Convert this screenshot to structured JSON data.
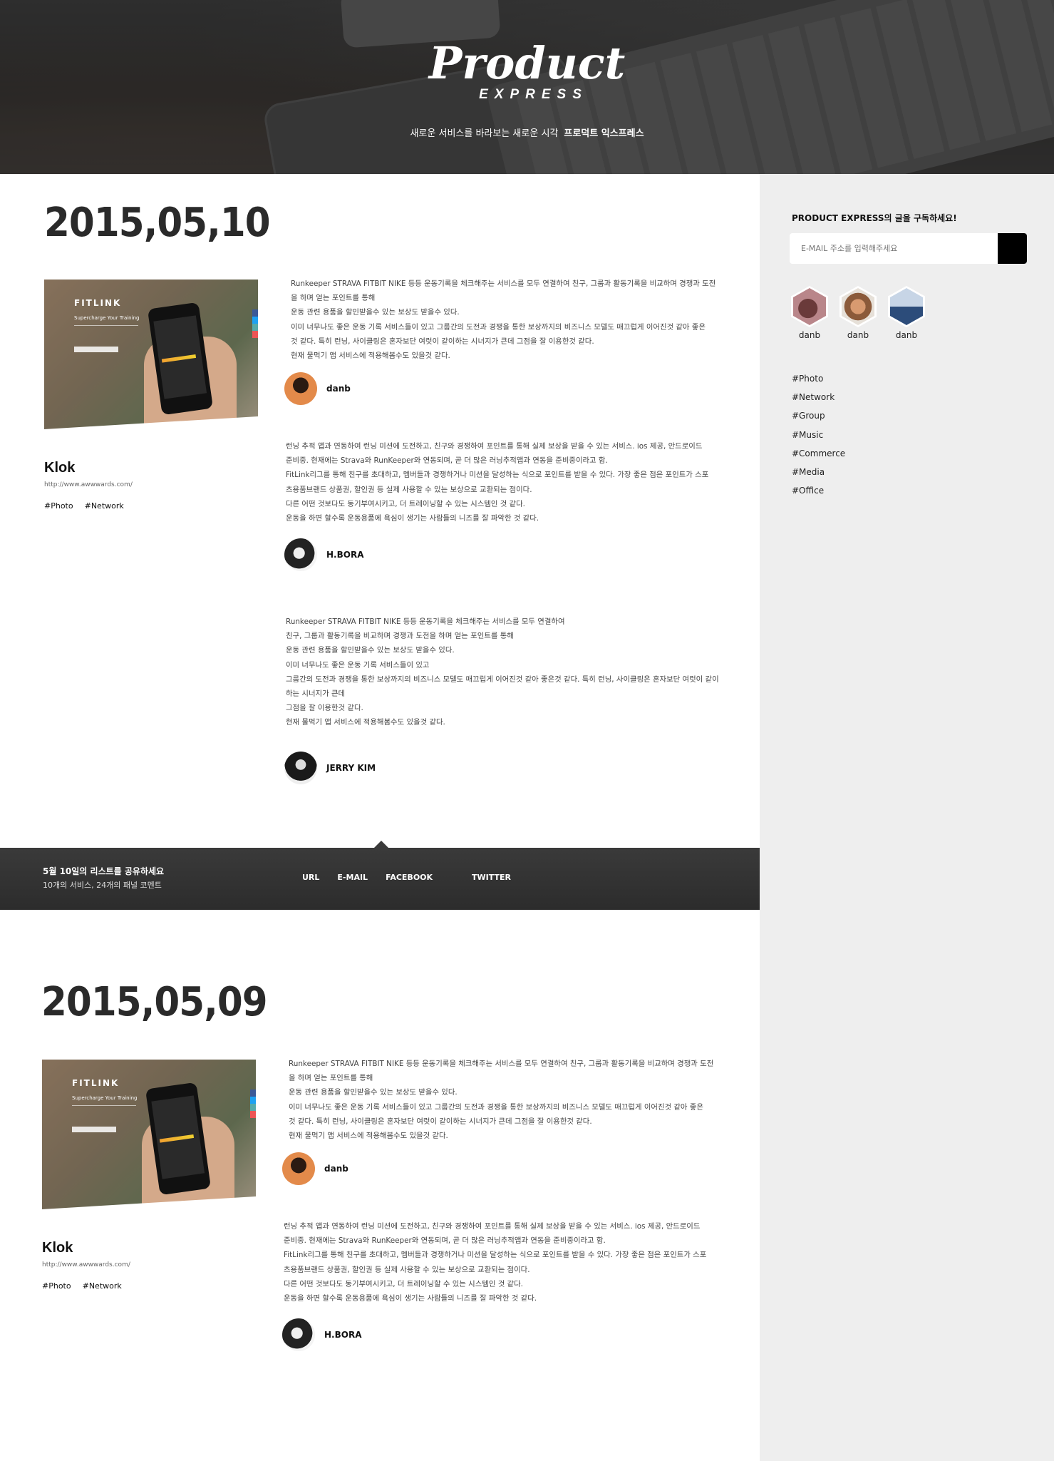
{
  "header": {
    "logo_main": "Product",
    "logo_sub": "EXPRESS",
    "tagline": "새로운 서비스를 바라보는 새로운 시각",
    "tagline_bold": "프로덕트 익스프레스"
  },
  "sidebar": {
    "subscribe_title": "PRODUCT EXPRESS의 글을 구독하세요!",
    "email_placeholder": "E-MAIL 주소를 입력해주세요",
    "users": [
      {
        "name": "danb"
      },
      {
        "name": "danb"
      },
      {
        "name": "danb"
      }
    ],
    "tags": [
      "#Photo",
      "#Network",
      "#Group",
      "#Music",
      "#Commerce",
      "#Media",
      "#Office"
    ]
  },
  "days": [
    {
      "date": "2015,05,10",
      "product": {
        "thumb_brand": "FITLINK",
        "thumb_tagline": "Supercharge Your Training",
        "name": "Klok",
        "url": "http://www.awwwards.com/",
        "tags": [
          "#Photo",
          "#Network"
        ]
      },
      "comments": [
        {
          "lines": [
            "Runkeeper STRAVA FITBIT NIKE 등등 운동기록을 체크해주는 서비스를 모두 연결하여 친구, 그룹과 활동기록을 비교하며 경쟁과 도전",
            "을 하며 얻는 포인트를 통해",
            "운동 관련 용품을 할인받을수 있는 보상도 받을수 있다.",
            "이미 너무나도 좋은 운동 기록 서비스들이 있고 그룹간의 도전과 경쟁을 통한 보상까지의 비즈니스 모델도 매끄럽게 이어진것 같아 좋은",
            "것 같다. 특히 런닝, 사이클링은 혼자보단 여럿이 같이하는 시너지가 큰데 그점을 잘 이용한것 같다.",
            "현재 물먹기 앱 서비스에 적용해봄수도 있을것 같다."
          ],
          "author": "danb"
        },
        {
          "lines": [
            "런닝 추적 앱과 연동하여 런닝 미션에 도전하고, 친구와 경쟁하여 포인트를 통해 실제 보상을 받을 수 있는 서비스. ios 제공, 안드로이드",
            "준비중. 현재에는 Strava와 RunKeeper와 연동되며, 곧 더 많은 러닝추적앱과 연동을 준비중이라고 함.",
            "FitLink리그를 통해 친구를 초대하고, 멤버들과 경쟁하거나 미션을 달성하는 식으로 포인트를 받을 수 있다. 가장 좋은 점은 포인트가 스포",
            "츠용품브랜드 상품권, 할인권 등 실제 사용할 수 있는 보상으로 교환되는 점이다.",
            "다른 어떤 것보다도 동기부여시키고, 더 트레이닝할 수 있는 시스템인 것 같다.",
            "운동을 하면 할수록 운동용품에 욕심이 생기는 사람들의 니즈를 잘 파악한 것 같다."
          ],
          "author": "H.BORA"
        },
        {
          "lines": [
            "Runkeeper STRAVA FITBIT NIKE 등등 운동기록을 체크해주는 서비스를 모두 연결하여",
            "친구, 그룹과 활동기록을 비교하며 경쟁과 도전을 하며 얻는 포인트를 통해",
            "운동 관련 용품을 할인받을수 있는 보상도 받을수 있다.",
            "이미 너무나도 좋은 운동 기록 서비스들이 있고",
            "그룹간의 도전과 경쟁을 통한 보상까지의 비즈니스 모델도 매끄럽게 이어진것 같아 좋은것 같다. 특히 런닝, 사이클링은 혼자보단 여럿이 같이",
            "하는 시너지가 큰데",
            "그점을 잘 이용한것 같다.",
            "현재 물먹기 앱 서비스에 적용해봄수도 있을것 같다."
          ],
          "author": "JERRY KIM"
        }
      ]
    },
    {
      "date": "2015,05,09",
      "product": {
        "thumb_brand": "FITLINK",
        "thumb_tagline": "Supercharge Your Training",
        "name": "Klok",
        "url": "http://www.awwwards.com/",
        "tags": [
          "#Photo",
          "#Network"
        ]
      },
      "comments": [
        {
          "lines": [
            "Runkeeper STRAVA FITBIT NIKE 등등 운동기록을 체크해주는 서비스를 모두 연결하여 친구, 그룹과 활동기록을 비교하며 경쟁과 도전",
            "을 하며 얻는 포인트를 통해",
            "운동 관련 용품을 할인받을수 있는 보상도 받을수 있다.",
            "이미 너무나도 좋은 운동 기록 서비스들이 있고 그룹간의 도전과 경쟁을 통한 보상까지의 비즈니스 모델도 매끄럽게 이어진것 같아 좋은",
            "것 같다. 특히 런닝, 사이클링은 혼자보단 여럿이 같이하는 시너지가 큰데 그점을 잘 이용한것 같다.",
            "현재 물먹기 앱 서비스에 적용해봄수도 있을것 같다."
          ],
          "author": "danb"
        },
        {
          "lines": [
            "런닝 추적 앱과 연동하여 런닝 미션에 도전하고, 친구와 경쟁하여 포인트를 통해 실제 보상을 받을 수 있는 서비스. ios 제공, 안드로이드",
            "준비중. 현재에는 Strava와 RunKeeper와 연동되며, 곧 더 많은 러닝추적앱과 연동을 준비중이라고 함.",
            "FitLink리그를 통해 친구를 초대하고, 멤버들과 경쟁하거나 미션을 달성하는 식으로 포인트를 받을 수 있다. 가장 좋은 점은 포인트가 스포",
            "츠용품브랜드 상품권, 할인권 등 실제 사용할 수 있는 보상으로 교환되는 점이다.",
            "다른 어떤 것보다도 동기부여시키고, 더 트레이닝할 수 있는 시스템인 것 같다.",
            "운동을 하면 할수록 운동용품에 욕심이 생기는 사람들의 니즈를 잘 파악한 것 같다."
          ],
          "author": "H.BORA"
        }
      ]
    }
  ],
  "share": {
    "title": "5월 10일의 리스트를 공유하세요",
    "subtitle": "10개의 서비스, 24개의 패널 코멘트",
    "links": [
      "URL",
      "E-MAIL",
      "FACEBOOK",
      "TWITTER"
    ]
  }
}
